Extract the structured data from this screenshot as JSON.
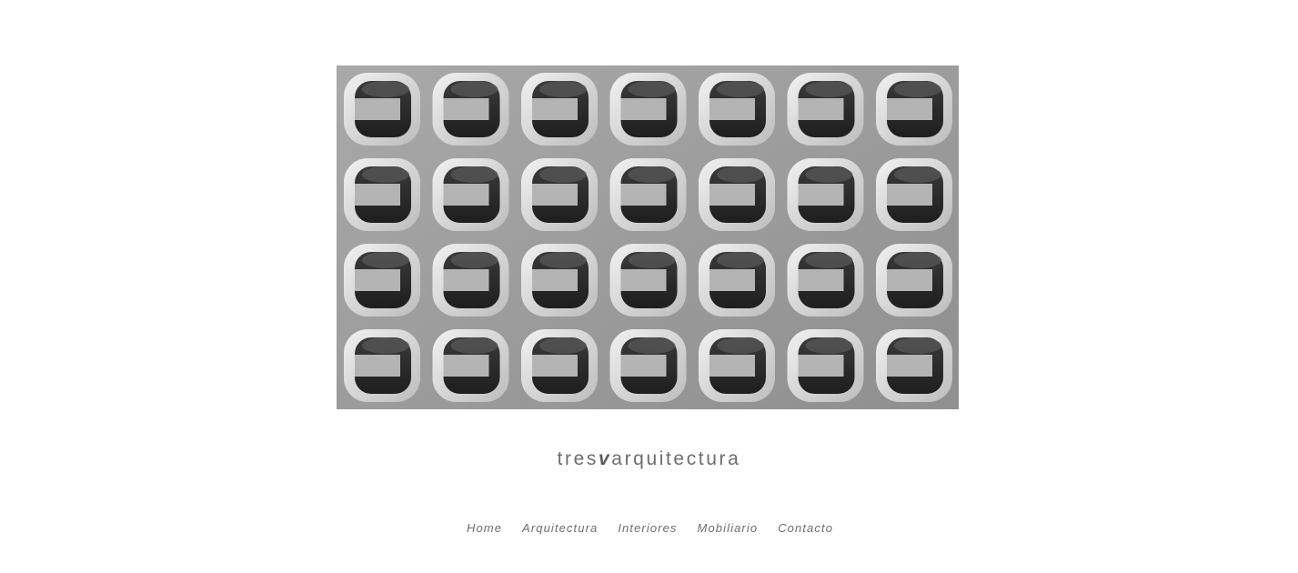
{
  "hero": {
    "image_description_icon": "concrete-breeze-block-photo",
    "rows": 4,
    "columns": 7
  },
  "brand": {
    "part1": "tres",
    "part2": "v",
    "part3": "arquitectura"
  },
  "nav": {
    "items": [
      {
        "label": "Home"
      },
      {
        "label": "Arquitectura"
      },
      {
        "label": "Interiores"
      },
      {
        "label": "Mobiliario"
      },
      {
        "label": "Contacto"
      }
    ]
  },
  "colors": {
    "background": "#ffffff",
    "text": "#6d6d6d",
    "photo_concrete": "#a3a3a3",
    "photo_shadow": "#2e2e2e"
  }
}
